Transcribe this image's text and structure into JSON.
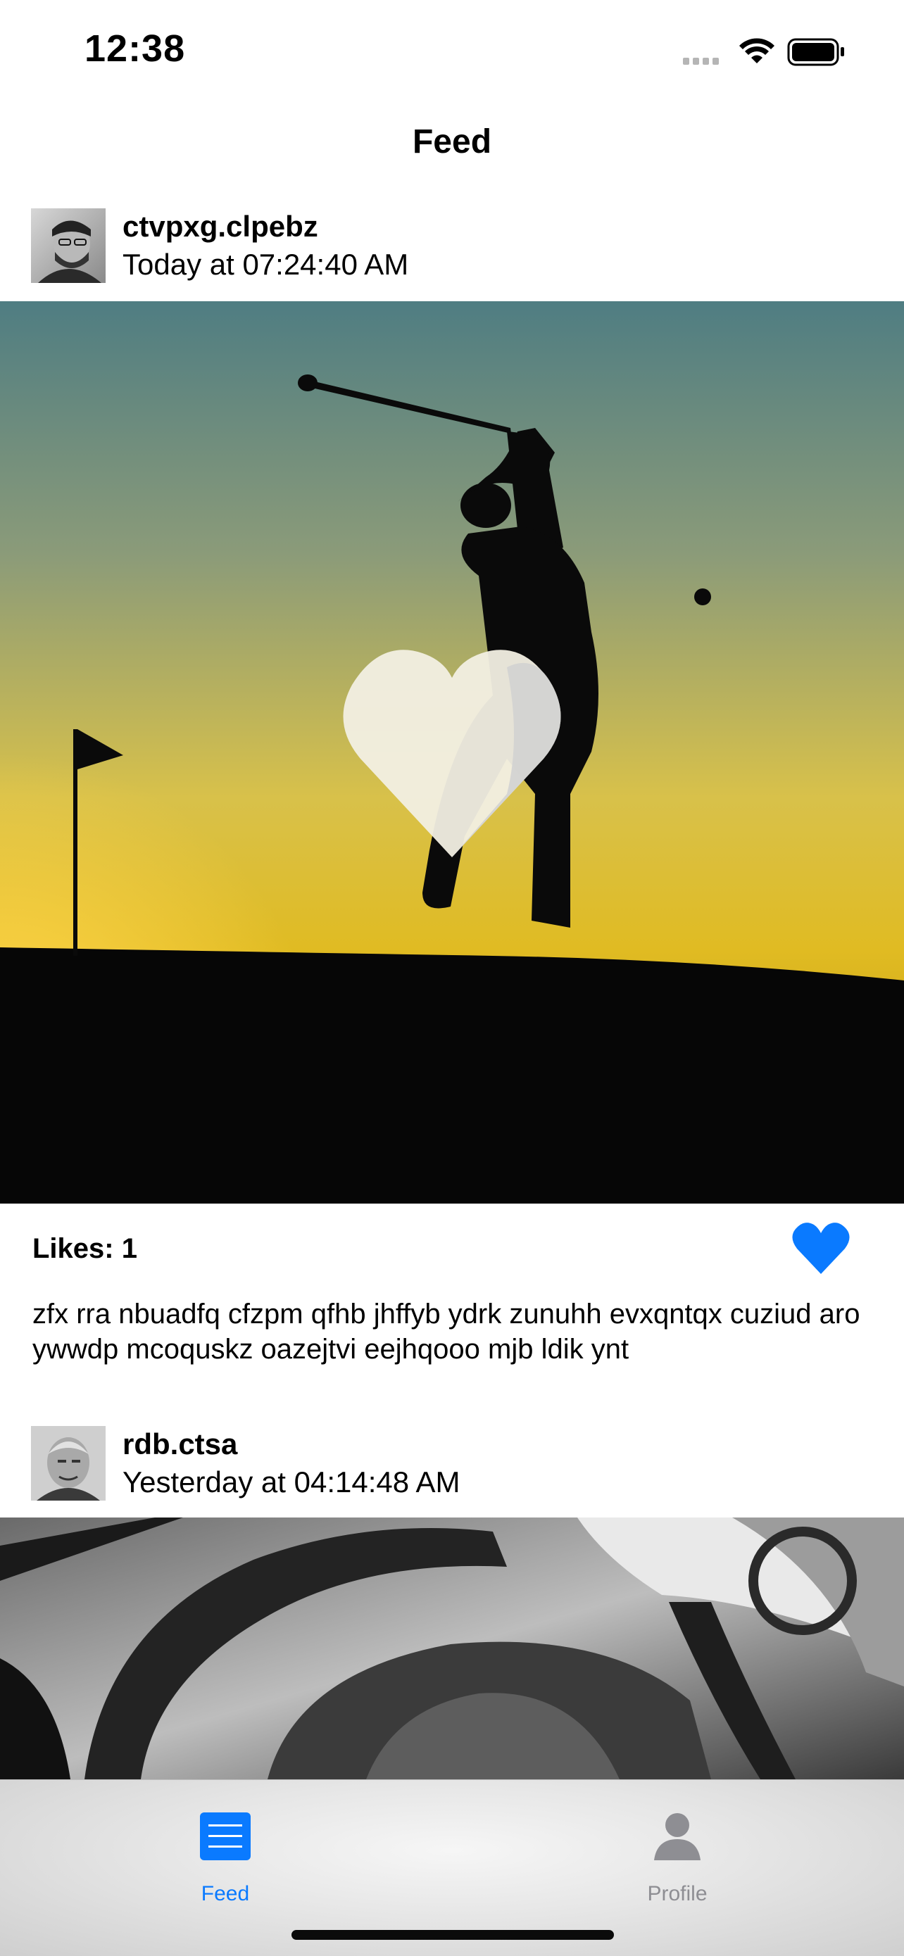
{
  "status_bar": {
    "time": "12:38"
  },
  "nav": {
    "title": "Feed"
  },
  "posts": [
    {
      "username": "ctvpxg.clpebz",
      "timestamp": "Today at 07:24:40 AM",
      "likes_text": "Likes: 1",
      "liked": true,
      "caption": "zfx rra nbuadfq cfzpm qfhb jhffyb ydrk zunuhh evxqntqx cuziud aro ywwdp mcoquskz oazejtvi eejhqooo mjb ldik ynt"
    },
    {
      "username": "rdb.ctsa",
      "timestamp": "Yesterday at 04:14:48 AM"
    }
  ],
  "tabs": [
    {
      "label": "Feed",
      "icon": "list-icon",
      "active": true
    },
    {
      "label": "Profile",
      "icon": "person-icon",
      "active": false
    }
  ],
  "colors": {
    "accent": "#0a7aff",
    "inactive": "#8e8e93",
    "heart_overlay": "#f2efe3"
  }
}
